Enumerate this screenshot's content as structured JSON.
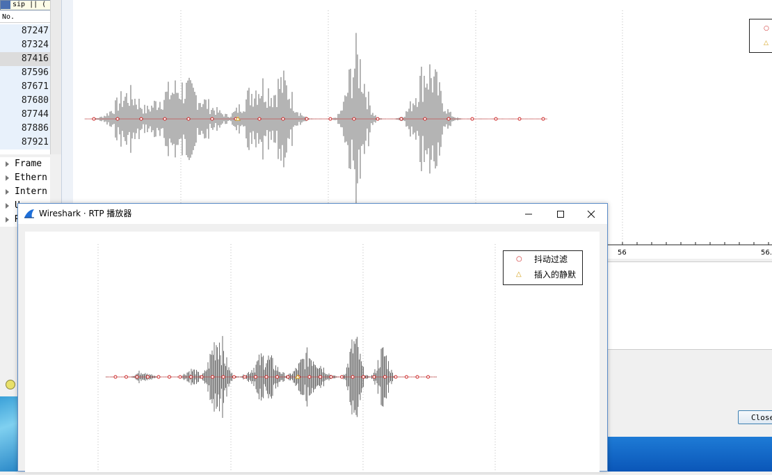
{
  "background_window": {
    "filter_text": "sip || (",
    "column_no": "No.",
    "packets": [
      "87247",
      "87324",
      "87416",
      "87596",
      "87671",
      "87680",
      "87744",
      "87886",
      "87921"
    ],
    "selected_index": 2,
    "details": [
      "Frame",
      "Ethern",
      "Intern",
      "U",
      "R"
    ],
    "graph": {
      "x_tick_labels": [
        "56",
        "56."
      ],
      "legend_markers": [
        "circle",
        "triangle"
      ]
    },
    "close_button_label": "Close"
  },
  "dialog": {
    "title": "Wireshark · RTP 播放器",
    "legend": [
      {
        "marker": "circle",
        "label": "抖动过滤",
        "color": "#cc2222"
      },
      {
        "marker": "triangle",
        "label": "插入的静默",
        "color": "#d4a017"
      }
    ]
  },
  "colors": {
    "waveform": "#6a6a6a",
    "jitter_marker": "#cc2222",
    "silence_marker": "#d4a017",
    "accent": "#1e6fd9"
  }
}
